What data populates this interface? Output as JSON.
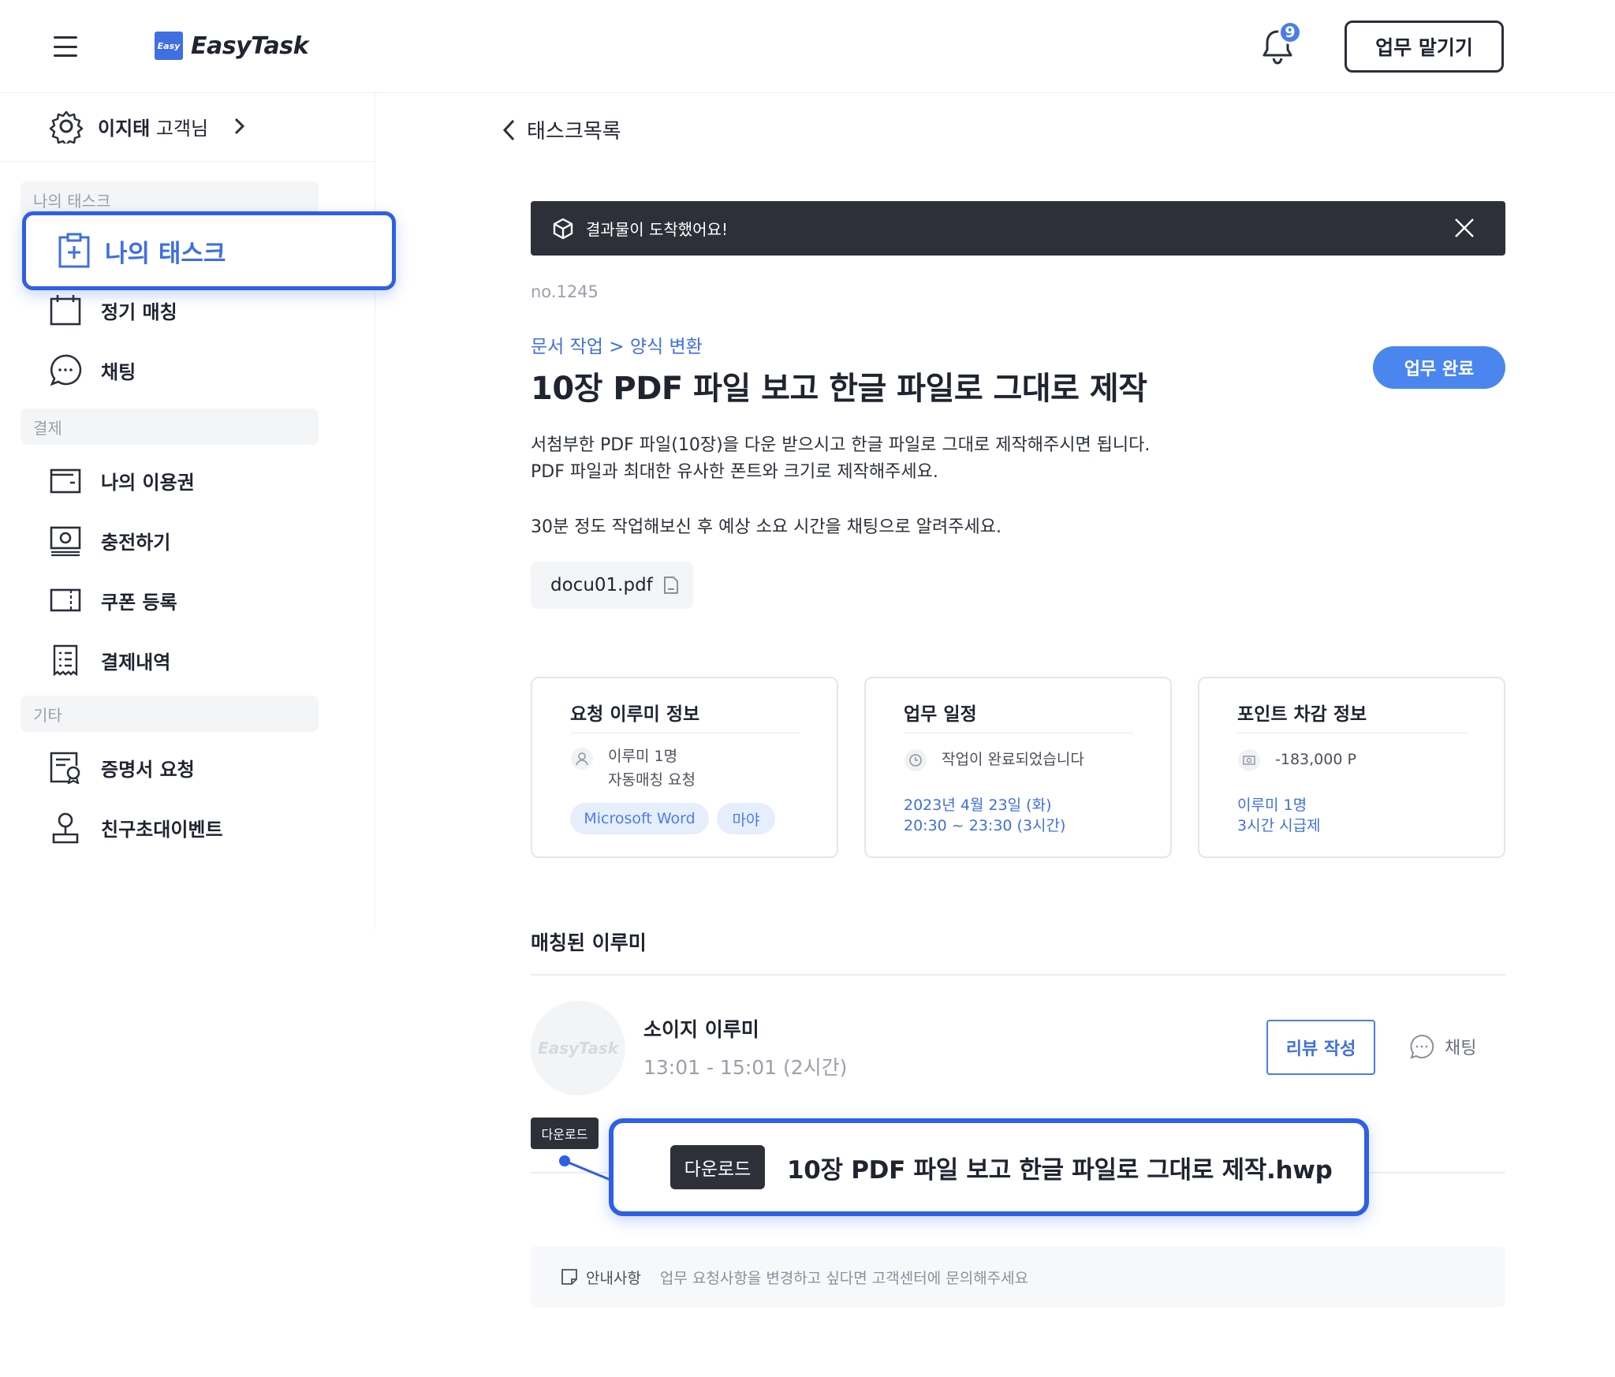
{
  "header": {
    "logo_mark": "Easy",
    "logo_text": "EasyTask",
    "notification_count": "9",
    "delegate_button": "업무 맡기기"
  },
  "sidebar": {
    "user_name": "이지태",
    "user_suffix": " 고객님",
    "sections": {
      "my_tasks": "나의 태스크",
      "payment": "결제",
      "etc": "기타"
    },
    "active_item": "나의 태스크",
    "items": {
      "regular_matching": "정기 매칭",
      "chat": "채팅",
      "my_pass": "나의 이용권",
      "charge": "충전하기",
      "coupon": "쿠폰 등록",
      "payment_history": "결제내역",
      "certificate": "증명서 요청",
      "invite_event": "친구초대이벤트"
    }
  },
  "main": {
    "back_label": "태스크목록",
    "banner_text": "결과물이 도착했어요!",
    "task_no": "no.1245",
    "category": "문서 작업 > 양식 변환",
    "title": "10장 PDF 파일 보고 한글 파일로 그대로 제작",
    "complete_button": "업무 완료",
    "description": {
      "line1": "서첨부한 PDF 파일(10장)을 다운 받으시고 한글 파일로 그대로 제작해주시면 됩니다.",
      "line2": "PDF 파일과 최대한 유사한 폰트와 크기로 제작해주세요.",
      "line3": "30분 정도 작업해보신 후 예상 소요 시간을 채팅으로 알려주세요."
    },
    "attachment": "docu01.pdf",
    "cards": {
      "request": {
        "title": "요청 이루미 정보",
        "count": "이루미 1명",
        "type": "자동매칭 요청",
        "tags": [
          "Microsoft Word",
          "마야"
        ]
      },
      "schedule": {
        "title": "업무 일정",
        "status": "작업이 완료되었습니다",
        "date": "2023년 4월 23일 (화)",
        "time": "20:30 ~ 23:30 (3시간)"
      },
      "points": {
        "title": "포인트 차감 정보",
        "amount": "-183,000 P",
        "count": "이루미 1명",
        "rate": "3시간 시급제"
      }
    },
    "matched": {
      "title": "매칭된 이루미",
      "avatar_text": "EasyTask",
      "name": "소이지 이루미",
      "time": "13:01 - 15:01 (2시간)",
      "review_button": "리뷰 작성",
      "chat_button": "채팅"
    },
    "download": {
      "tooltip": "다운로드",
      "button": "다운로드",
      "filename": "10장 PDF 파일 보고 한글 파일로 그대로 제작.hwp"
    },
    "notice": {
      "label": "안내사항",
      "message": "업무 요청사항을 변경하고 싶다면 고객센터에 문의해주세요"
    }
  },
  "colors": {
    "accent": "#3f6fe0",
    "highlight_border": "#2f5fe3",
    "dark": "#2d3039"
  }
}
